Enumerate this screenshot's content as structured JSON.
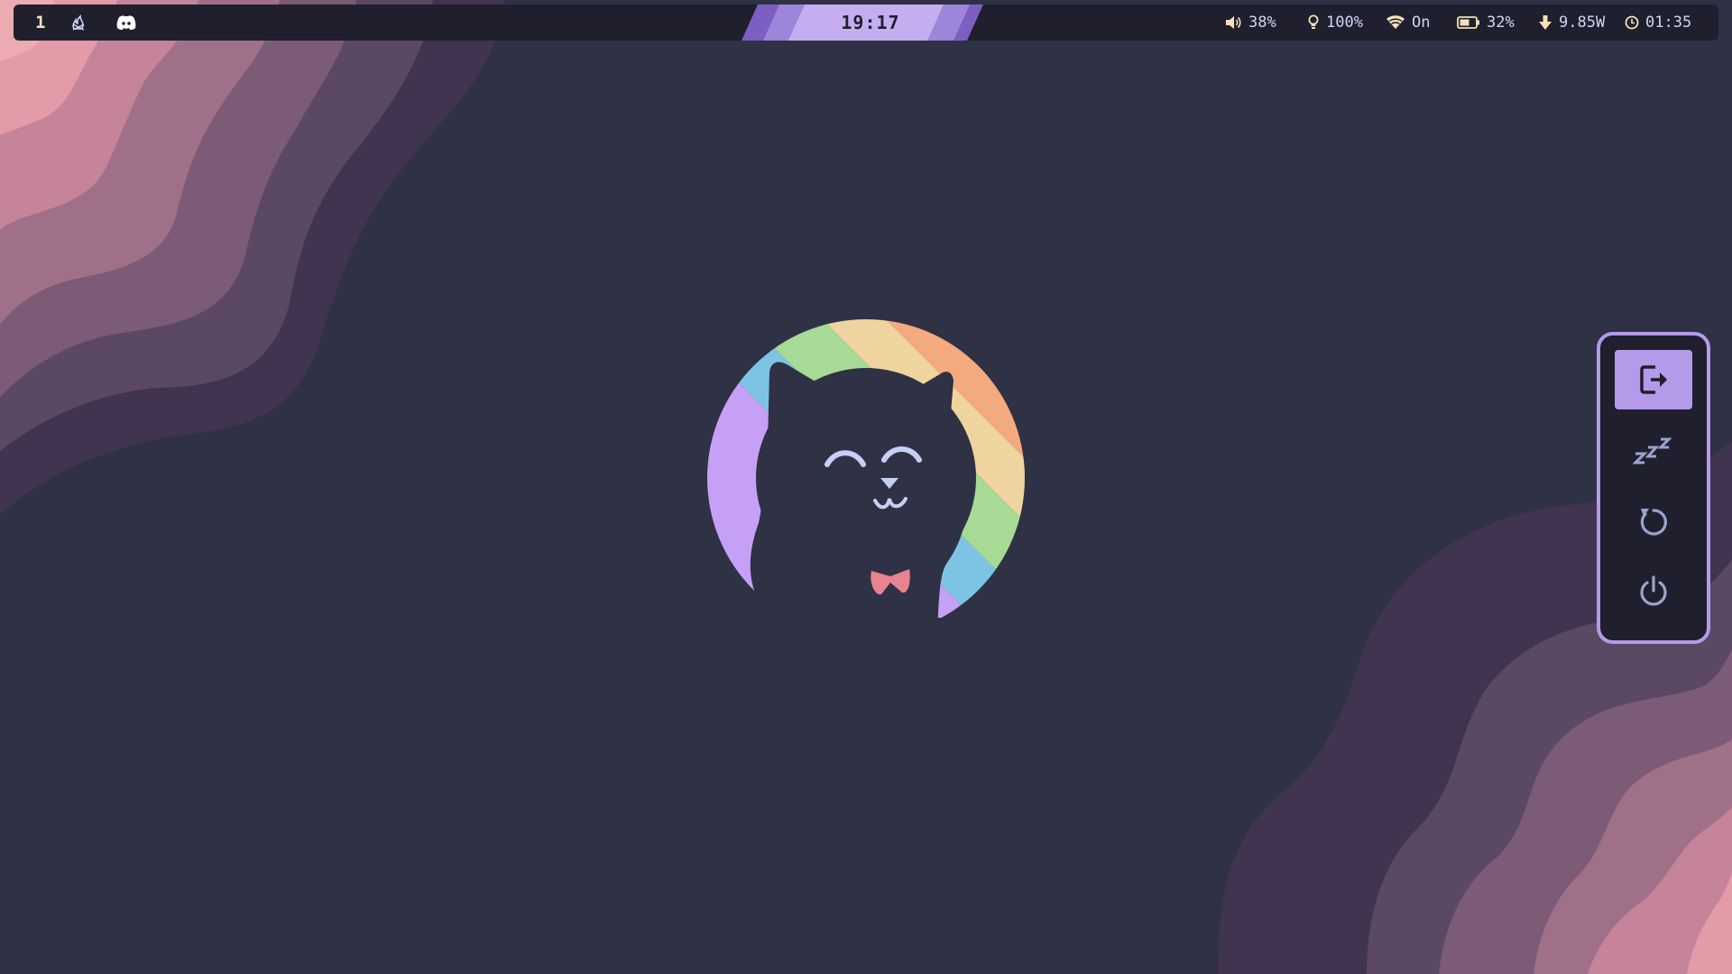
{
  "topbar": {
    "workspace": "1",
    "apps": [
      "campfire-icon",
      "discord-icon"
    ],
    "clock": "19:17",
    "volume": "38%",
    "brightness": "100%",
    "wifi": "On",
    "battery": "32%",
    "power_draw": "9.85W",
    "uptime": "01:35"
  },
  "power_menu": {
    "items": [
      "logout-icon",
      "sleep-icon",
      "reboot-icon",
      "shutdown-icon"
    ],
    "selected": "logout-icon"
  },
  "colors": {
    "bar_bg": "#1f1f2e",
    "accent": "#b49ae8",
    "text": "#cdd6f4",
    "desktop_bg": "#2f3145",
    "workspace": "#f5e0b8"
  }
}
